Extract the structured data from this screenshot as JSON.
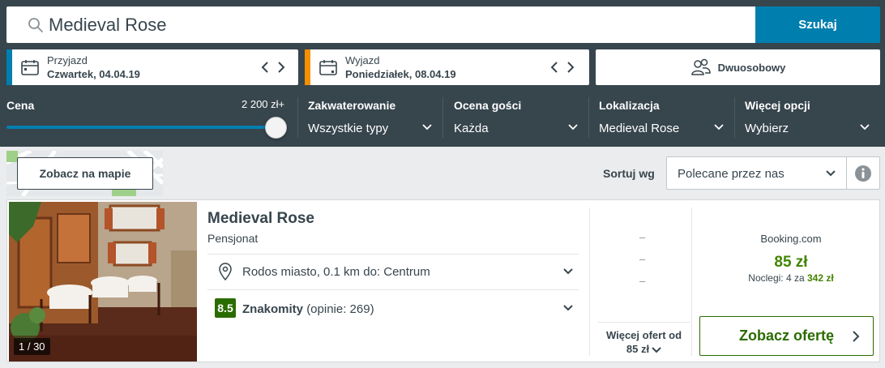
{
  "search": {
    "value": "Medieval Rose",
    "button_label": "Szukaj"
  },
  "checkin": {
    "label": "Przyjazd",
    "value": "Czwartek, 04.04.19",
    "stripe_color": "#007faf"
  },
  "checkout": {
    "label": "Wyjazd",
    "value": "Poniedziałek, 08.04.19",
    "stripe_color": "#f48f00"
  },
  "room": {
    "label": "Dwuosobowy"
  },
  "filters": {
    "price": {
      "label": "Cena",
      "value": "2 200 zł+",
      "slider_position": 1.0
    },
    "accommodation": {
      "label": "Zakwaterowanie",
      "value": "Wszystkie typy"
    },
    "guest_rating": {
      "label": "Ocena gości",
      "value": "Każda"
    },
    "location": {
      "label": "Lokalizacja",
      "value": "Medieval Rose"
    },
    "more": {
      "label": "Więcej opcji",
      "value": "Wybierz"
    }
  },
  "map": {
    "button_label": "Zobacz na mapie"
  },
  "sort": {
    "label": "Sortuj wg",
    "value": "Polecane przez nas"
  },
  "hotel": {
    "name": "Medieval Rose",
    "type": "Pensjonat",
    "location": "Rodos miasto, 0.1 km do: Centrum",
    "rating_score": "8.5",
    "rating_word": "Znakomity",
    "rating_count": "(opinie: 269)",
    "photo_counter": "1 / 30",
    "placeholder_dashes": [
      "–",
      "–",
      "–"
    ],
    "more_deals_line1": "Więcej ofert od",
    "more_deals_line2": "85 zł",
    "deal": {
      "site": "Booking.com",
      "price": "85 zł",
      "nights_text": "Noclegi: 4 za",
      "nights_total": "342 zł",
      "button_label": "Zobacz ofertę"
    }
  },
  "colors": {
    "header_bg": "#37454d",
    "accent_blue": "#007faf",
    "rating_green": "#2b6c00",
    "price_green": "#428500"
  }
}
